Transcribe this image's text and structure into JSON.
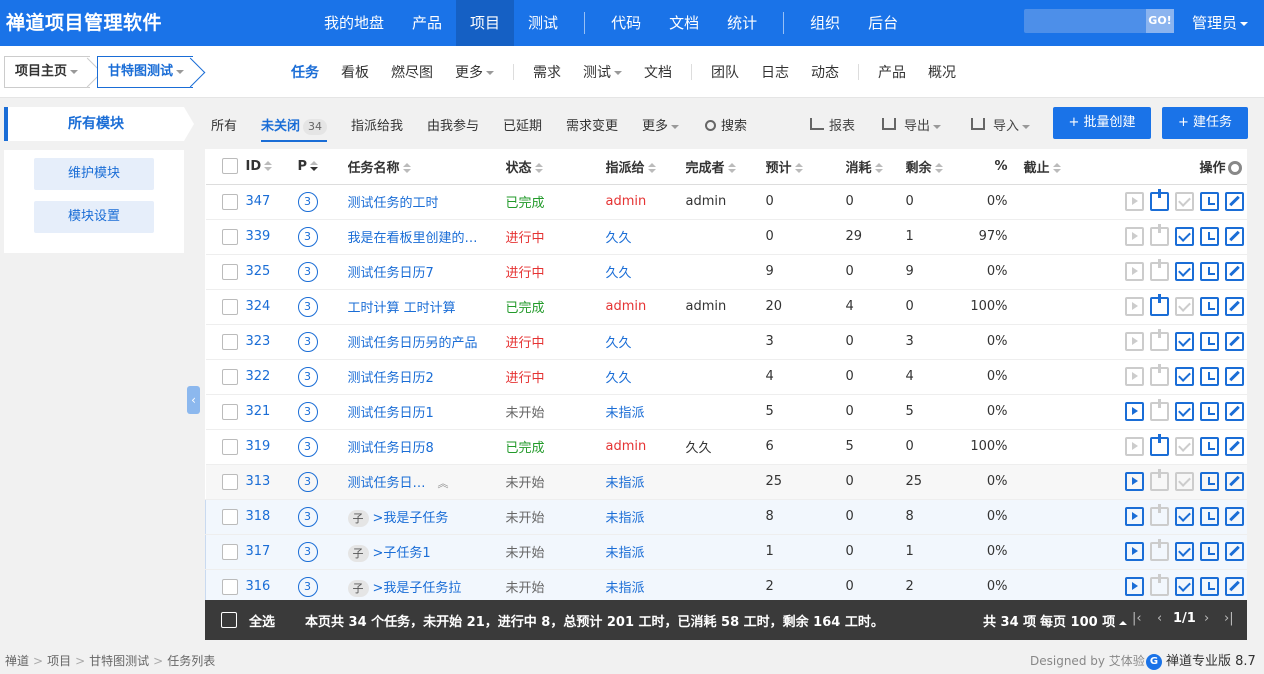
{
  "app": {
    "brand": "禅道项目管理软件"
  },
  "main_nav": [
    "我的地盘",
    "产品",
    "项目",
    "测试",
    "代码",
    "文档",
    "统计",
    "组织",
    "后台"
  ],
  "main_nav_active": 2,
  "search": {
    "go": "GO!",
    "value": ""
  },
  "user": "管理员",
  "breadcrumb_top": {
    "home": "项目主页",
    "project": "甘特图测试"
  },
  "sub_nav": [
    "任务",
    "看板",
    "燃尽图",
    "更多",
    "需求",
    "测试",
    "文档",
    "团队",
    "日志",
    "动态",
    "产品",
    "概况"
  ],
  "sub_nav_active": 0,
  "sidebar": {
    "head": "所有模块",
    "maintain": "维护模块",
    "settings": "模块设置"
  },
  "filters": {
    "all": "所有",
    "unclosed": "未关闭",
    "unclosed_count": "34",
    "assigned": "指派给我",
    "involved": "由我参与",
    "delayed": "已延期",
    "changed": "需求变更",
    "more": "更多",
    "search": "搜索"
  },
  "tools": {
    "report": "报表",
    "export": "导出",
    "import": "导入",
    "batch_create": "+ 批量创建",
    "create": "+ 建任务"
  },
  "columns": {
    "id": "ID",
    "pri": "P",
    "name": "任务名称",
    "status": "状态",
    "assigned": "指派给",
    "finisher": "完成者",
    "estimate": "预计",
    "consumed": "消耗",
    "left": "剩余",
    "progress": "%",
    "deadline": "截止",
    "actions": "操作"
  },
  "tasks": [
    {
      "id": "347",
      "pri": "3",
      "name": "测试任务的工时",
      "status": "已完成",
      "assigned": "admin",
      "finisher": "admin",
      "estimate": "0",
      "consumed": "0",
      "left": "0",
      "progress": "0%"
    },
    {
      "id": "339",
      "pri": "3",
      "name": "我是在看板里创建的…",
      "status": "进行中",
      "assigned": "久久",
      "finisher": "",
      "estimate": "0",
      "consumed": "29",
      "left": "1",
      "progress": "97%"
    },
    {
      "id": "325",
      "pri": "3",
      "name": "测试任务日历7",
      "status": "进行中",
      "assigned": "久久",
      "finisher": "",
      "estimate": "9",
      "consumed": "0",
      "left": "9",
      "progress": "0%"
    },
    {
      "id": "324",
      "pri": "3",
      "name": "工时计算 工时计算",
      "status": "已完成",
      "assigned": "admin",
      "finisher": "admin",
      "estimate": "20",
      "consumed": "4",
      "left": "0",
      "progress": "100%"
    },
    {
      "id": "323",
      "pri": "3",
      "name": "测试任务日历另的产品",
      "status": "进行中",
      "assigned": "久久",
      "finisher": "",
      "estimate": "3",
      "consumed": "0",
      "left": "3",
      "progress": "0%"
    },
    {
      "id": "322",
      "pri": "3",
      "name": "测试任务日历2",
      "status": "进行中",
      "assigned": "久久",
      "finisher": "",
      "estimate": "4",
      "consumed": "0",
      "left": "4",
      "progress": "0%"
    },
    {
      "id": "321",
      "pri": "3",
      "name": "测试任务日历1",
      "status": "未开始",
      "assigned": "未指派",
      "finisher": "",
      "estimate": "5",
      "consumed": "0",
      "left": "5",
      "progress": "0%"
    },
    {
      "id": "319",
      "pri": "3",
      "name": "测试任务日历8",
      "status": "已完成",
      "assigned": "admin",
      "finisher": "久久",
      "estimate": "6",
      "consumed": "5",
      "left": "0",
      "progress": "100%"
    },
    {
      "id": "313",
      "pri": "3",
      "name": "测试任务日…",
      "status": "未开始",
      "assigned": "未指派",
      "finisher": "",
      "estimate": "25",
      "consumed": "0",
      "left": "25",
      "progress": "0%"
    },
    {
      "id": "318",
      "pri": "3",
      "child_tag": "子",
      "name": ">我是子任务",
      "status": "未开始",
      "assigned": "未指派",
      "finisher": "",
      "estimate": "8",
      "consumed": "0",
      "left": "8",
      "progress": "0%"
    },
    {
      "id": "317",
      "pri": "3",
      "child_tag": "子",
      "name": ">子任务1",
      "status": "未开始",
      "assigned": "未指派",
      "finisher": "",
      "estimate": "1",
      "consumed": "0",
      "left": "1",
      "progress": "0%"
    },
    {
      "id": "316",
      "pri": "3",
      "child_tag": "子",
      "name": ">我是子任务拉",
      "status": "未开始",
      "assigned": "未指派",
      "finisher": "",
      "estimate": "2",
      "consumed": "0",
      "left": "2",
      "progress": "0%"
    }
  ],
  "footer": {
    "select_all": "全选",
    "summary": "本页共 34 个任务，未开始 21，进行中 8，总预计 201 工时，已消耗 58 工时，剩余 164 工时。",
    "total": "共 34 项",
    "per_page": "每页 100 项",
    "page": "1/1"
  },
  "bottom_breadcrumb": [
    "禅道",
    "项目",
    "甘特图测试",
    "任务列表"
  ],
  "designed_by": "Designed by 艾体验",
  "version": "禅道专业版 8.7",
  "colors": {
    "primary": "#1a73e8",
    "done": "#229a2a",
    "doing": "#e53333"
  }
}
